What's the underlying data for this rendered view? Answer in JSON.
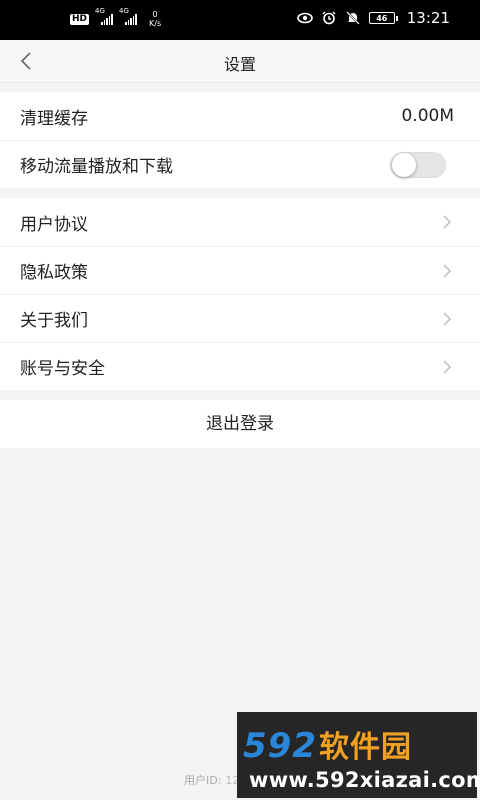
{
  "status_bar": {
    "hd_badge": "HD",
    "sim1_tag": "4G",
    "sim2_tag": "4G",
    "speed_value": "0",
    "speed_unit": "K/s",
    "battery": "46",
    "time": "13:21"
  },
  "header": {
    "title": "设置",
    "back_icon": "chevron-left-icon"
  },
  "cache_section": {
    "clear_cache_label": "清理缓存",
    "clear_cache_value": "0.00M",
    "mobile_data_label": "移动流量播放和下载",
    "mobile_data_enabled": false
  },
  "links": {
    "items": [
      {
        "label": "用户协议"
      },
      {
        "label": "隐私政策"
      },
      {
        "label": "关于我们"
      },
      {
        "label": "账号与安全"
      }
    ]
  },
  "logout_label": "退出登录",
  "footer": {
    "user_id_label": "用户ID:",
    "user_id_value": "12"
  },
  "watermark": {
    "brand_num": "592",
    "brand_cn": "软件园",
    "url": "www.592xiazai.com"
  },
  "colors": {
    "background": "#f4f4f4",
    "card": "#ffffff",
    "watermark_blue": "#2a86d8",
    "watermark_orange": "#f0a022"
  }
}
